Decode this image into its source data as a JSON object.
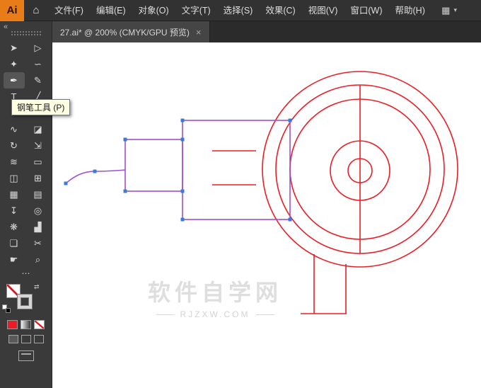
{
  "colors": {
    "red": "#ed1c24",
    "purple": "#a04fd0",
    "anchor_blue": "#3a7bd5",
    "watermark_gray": "#dcdcdc",
    "logo_orange": "#e87d17",
    "ui_dark": "#3a3a3a"
  },
  "menubar": {
    "logo": "Ai",
    "home_icon": "⌂",
    "items": [
      {
        "id": "file",
        "label": "文件(F)"
      },
      {
        "id": "edit",
        "label": "编辑(E)"
      },
      {
        "id": "object",
        "label": "对象(O)"
      },
      {
        "id": "type",
        "label": "文字(T)"
      },
      {
        "id": "select",
        "label": "选择(S)"
      },
      {
        "id": "effect",
        "label": "效果(C)"
      },
      {
        "id": "view",
        "label": "视图(V)"
      },
      {
        "id": "window",
        "label": "窗口(W)"
      },
      {
        "id": "help",
        "label": "帮助(H)"
      }
    ],
    "workspace_icon": "▦",
    "workspace_caret": "▾"
  },
  "tabbar": {
    "title": "27.ai* @ 200% (CMYK/GPU 预览)",
    "close_icon": "×"
  },
  "toolbar": {
    "collapse_icon": "«",
    "edit_toolbar_icon": "⋯",
    "swap_icon": "⇄",
    "tools": [
      {
        "id": "selection-tool",
        "glyph": "➤",
        "active": false
      },
      {
        "id": "direct-selection-tool",
        "glyph": "▷",
        "active": false
      },
      {
        "id": "magic-wand-tool",
        "glyph": "✦",
        "active": false
      },
      {
        "id": "lasso-tool",
        "glyph": "∽",
        "active": false
      },
      {
        "id": "pen-tool",
        "glyph": "✒",
        "active": true
      },
      {
        "id": "curvature-tool",
        "glyph": "✎",
        "active": false
      },
      {
        "id": "type-tool",
        "glyph": "T",
        "active": false
      },
      {
        "id": "line-segment-tool",
        "glyph": "╱",
        "active": false
      },
      {
        "id": "ellipse-tool",
        "glyph": "○",
        "active": false
      },
      {
        "id": "paintbrush-tool",
        "glyph": "✐",
        "active": false
      },
      {
        "id": "shaper-tool",
        "glyph": "∿",
        "active": false
      },
      {
        "id": "eraser-tool",
        "glyph": "◪",
        "active": false
      },
      {
        "id": "rotate-tool",
        "glyph": "↻",
        "active": false
      },
      {
        "id": "scale-tool",
        "glyph": "⇲",
        "active": false
      },
      {
        "id": "width-tool",
        "glyph": "≋",
        "active": false
      },
      {
        "id": "free-transform-tool",
        "glyph": "▭",
        "active": false
      },
      {
        "id": "shape-builder-tool",
        "glyph": "◫",
        "active": false
      },
      {
        "id": "perspective-grid-tool",
        "glyph": "⊞",
        "active": false
      },
      {
        "id": "mesh-tool",
        "glyph": "▦",
        "active": false
      },
      {
        "id": "gradient-tool",
        "glyph": "▤",
        "active": false
      },
      {
        "id": "eyedropper-tool",
        "glyph": "↧",
        "active": false
      },
      {
        "id": "blend-tool",
        "glyph": "◎",
        "active": false
      },
      {
        "id": "symbol-sprayer-tool",
        "glyph": "❋",
        "active": false
      },
      {
        "id": "column-graph-tool",
        "glyph": "▟",
        "active": false
      },
      {
        "id": "artboard-tool",
        "glyph": "❏",
        "active": false
      },
      {
        "id": "slice-tool",
        "glyph": "✂",
        "active": false
      },
      {
        "id": "hand-tool",
        "glyph": "☛",
        "active": false
      },
      {
        "id": "zoom-tool",
        "glyph": "⌕",
        "active": false
      }
    ]
  },
  "tooltip": {
    "text": "钢笔工具 (P)"
  },
  "watermark": {
    "title": "软件自学网",
    "subtitle": "RJZXW.COM"
  }
}
